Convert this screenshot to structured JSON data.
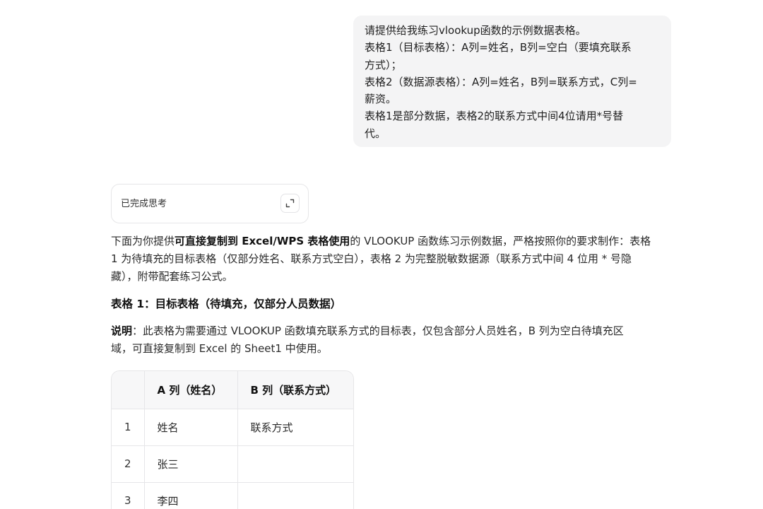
{
  "user_message": {
    "lines": [
      "请提供给我练习vlookup函数的示例数据表格。",
      "表格1（目标表格）：A列=姓名，B列=空白（要填充联系",
      "方式）；",
      "表格2（数据源表格）：A列=姓名，B列=联系方式，C列=",
      "薪资。",
      "表格1是部分数据，表格2的联系方式中间4位请用*号替",
      "代。"
    ]
  },
  "thinking": {
    "label": "已完成思考",
    "expand_icon": "expand-icon"
  },
  "answer": {
    "intro": {
      "l1_pre": "下面为你提供",
      "l1_bold": "可直接复制到 Excel/WPS 表格使用",
      "l1_post": "的 VLOOKUP 函数练习示例数据，严格按照你的要求制作：表格",
      "l2": "1 为待填充的目标表格（仅部分姓名、联系方式空白），表格 2 为完整脱敏数据源（联系方式中间 4 位用 * 号隐",
      "l3": "藏），附带配套练习公式。"
    },
    "heading": "表格 1：目标表格（待填充，仅部分人员数据）",
    "note": {
      "label": "说明",
      "l1": "：此表格为需要通过 VLOOKUP 函数填充联系方式的目标表，仅包含部分人员姓名，B 列为空白待填充区",
      "l2": "域，可直接复制到 Excel 的 Sheet1 中使用。"
    },
    "table": {
      "headers": [
        "",
        "A 列（姓名）",
        "B 列（联系方式）"
      ],
      "rows": [
        [
          "1",
          "姓名",
          "联系方式"
        ],
        [
          "2",
          "张三",
          ""
        ],
        [
          "3",
          "李四",
          ""
        ]
      ]
    }
  }
}
